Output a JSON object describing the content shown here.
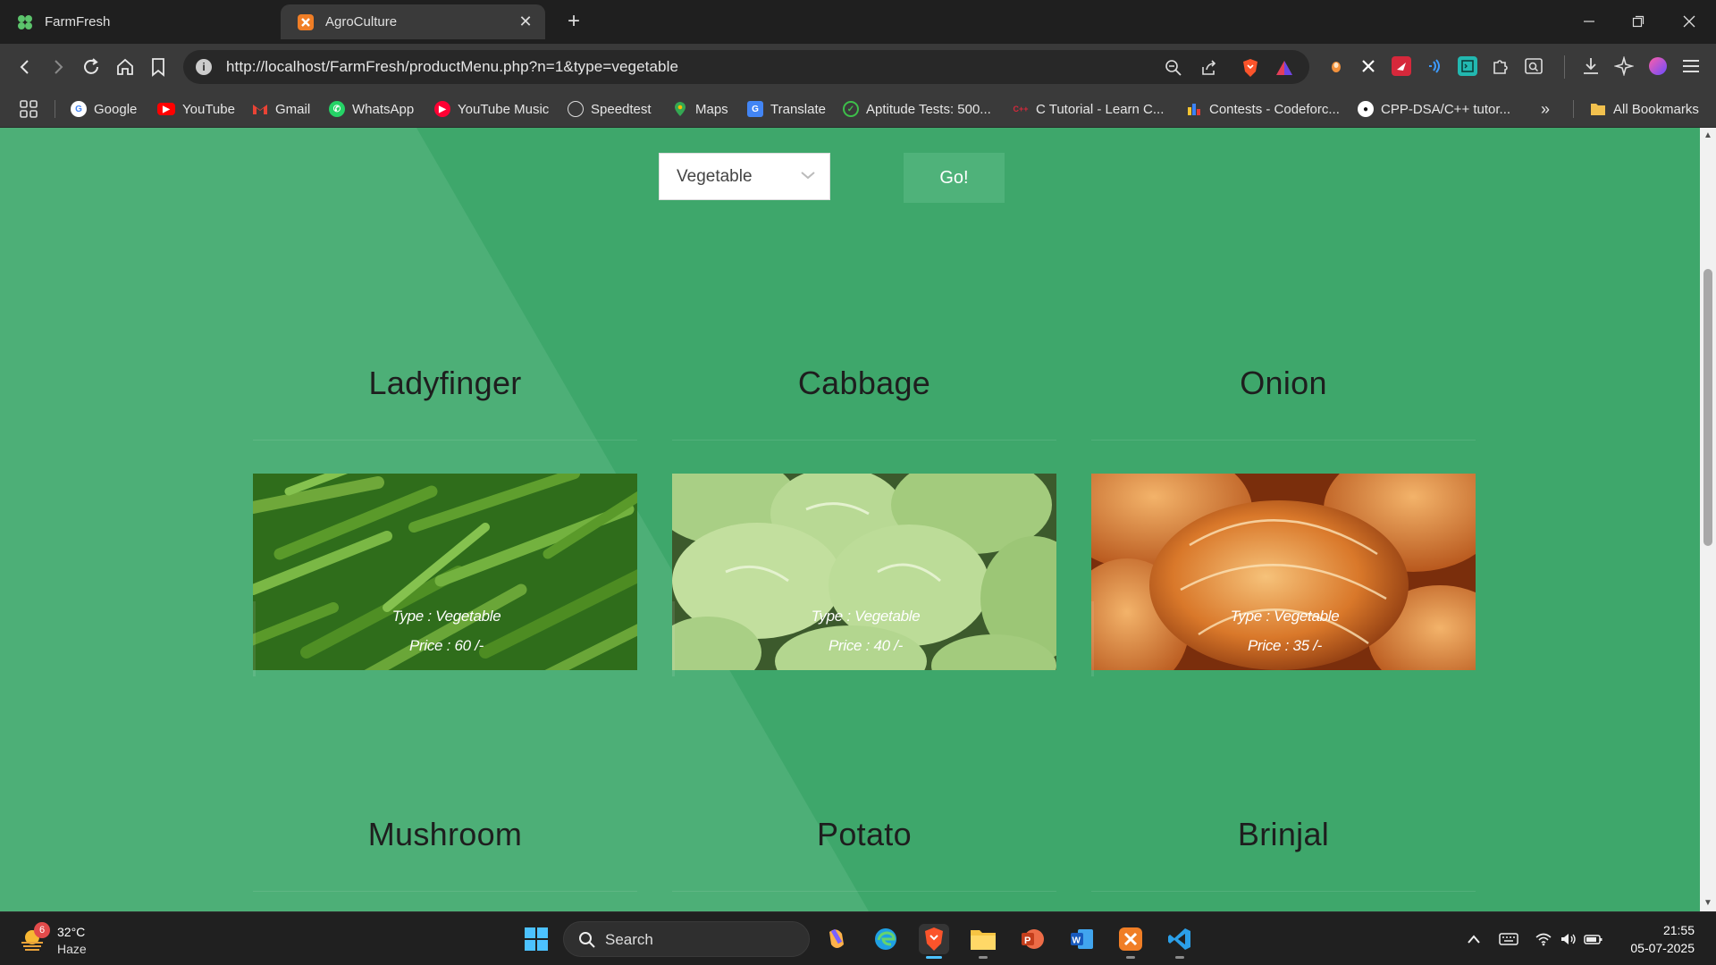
{
  "browser": {
    "tabs": [
      {
        "label": "FarmFresh",
        "icon": "farmfresh-clover-icon",
        "active": false
      },
      {
        "label": "AgroCulture",
        "icon": "xampp-icon",
        "active": true
      }
    ],
    "url": "http://localhost/FarmFresh/productMenu.php?n=1&type=vegetable",
    "bookmarks": [
      {
        "label": "Google",
        "icon": "google-icon"
      },
      {
        "label": "YouTube",
        "icon": "youtube-icon"
      },
      {
        "label": "Gmail",
        "icon": "gmail-icon"
      },
      {
        "label": "WhatsApp",
        "icon": "whatsapp-icon"
      },
      {
        "label": "YouTube Music",
        "icon": "youtube-music-icon"
      },
      {
        "label": "Speedtest",
        "icon": "speedtest-icon"
      },
      {
        "label": "Maps",
        "icon": "maps-icon"
      },
      {
        "label": "Translate",
        "icon": "translate-icon"
      },
      {
        "label": "Aptitude Tests: 500...",
        "icon": "check-circle-icon"
      },
      {
        "label": "C Tutorial - Learn C...",
        "icon": "cpp-icon"
      },
      {
        "label": "Contests - Codeforc...",
        "icon": "codeforces-icon"
      },
      {
        "label": "CPP-DSA/C++ tutor...",
        "icon": "github-icon"
      }
    ],
    "all_bookmarks": "All Bookmarks",
    "overflow": "»"
  },
  "filter": {
    "selected": "Vegetable",
    "go_label": "Go!"
  },
  "products": [
    {
      "name": "Ladyfinger",
      "type_line": "Type : Vegetable",
      "price_line": "Price : 60 /-",
      "image": "okra-photo"
    },
    {
      "name": "Cabbage",
      "type_line": "Type : Vegetable",
      "price_line": "Price : 40 /-",
      "image": "cabbage-photo"
    },
    {
      "name": "Onion",
      "type_line": "Type : Vegetable",
      "price_line": "Price : 35 /-",
      "image": "onion-photo"
    },
    {
      "name": "Mushroom"
    },
    {
      "name": "Potato"
    },
    {
      "name": "Brinjal"
    }
  ],
  "taskbar": {
    "weather_temp": "32°C",
    "weather_desc": "Haze",
    "weather_badge": "6",
    "search_label": "Search",
    "time": "21:55",
    "date": "05-07-2025"
  },
  "colors": {
    "page_bg": "#3ea76b",
    "diag_light": "#4daf77",
    "go_button": "#4fb27a",
    "text_dark": "#1e1e1e"
  }
}
